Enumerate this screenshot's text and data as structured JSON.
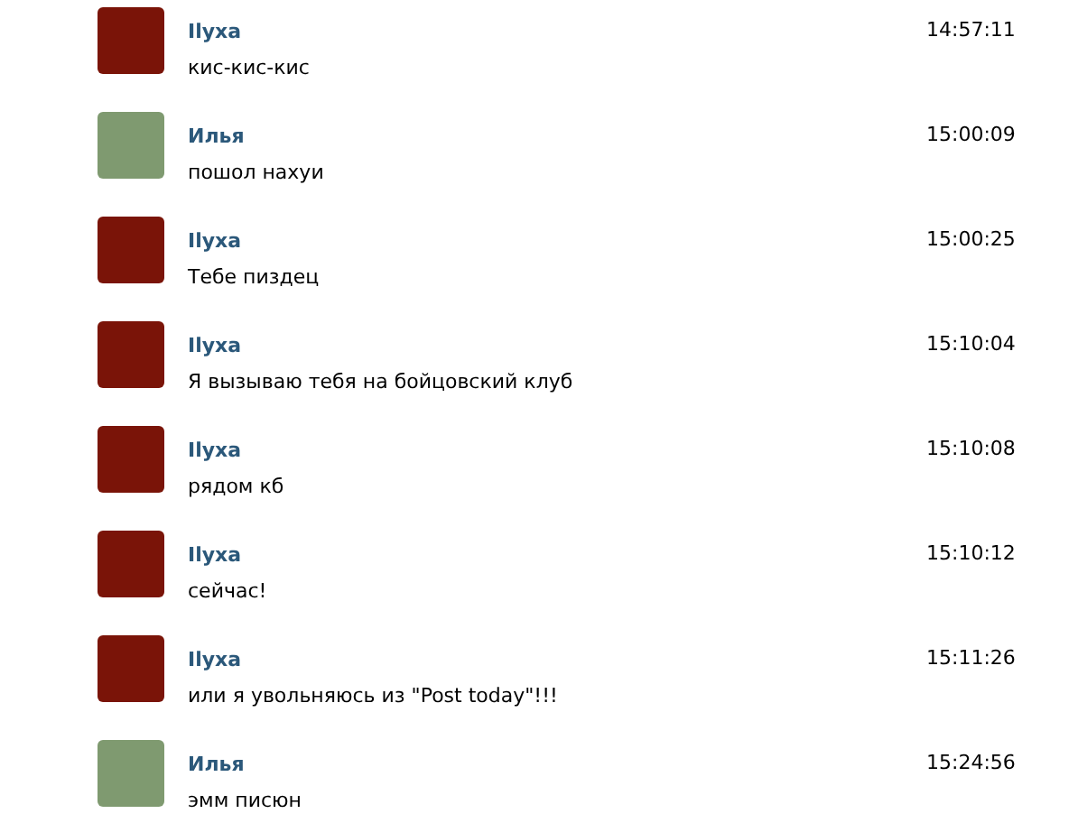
{
  "messages": [
    {
      "author": "Ilyxa",
      "text": "кис-кис-кис",
      "time": "14:57:11",
      "color": "#7a1408"
    },
    {
      "author": "Илья",
      "text": "пошол нахуи",
      "time": "15:00:09",
      "color": "#7f9a70"
    },
    {
      "author": "Ilyxa",
      "text": "Тебе пиздец",
      "time": "15:00:25",
      "color": "#7a1408"
    },
    {
      "author": "Ilyxa",
      "text": "Я вызываю тебя на бойцовский клуб",
      "time": "15:10:04",
      "color": "#7a1408"
    },
    {
      "author": "Ilyxa",
      "text": "рядом кб",
      "time": "15:10:08",
      "color": "#7a1408"
    },
    {
      "author": "Ilyxa",
      "text": "сейчас!",
      "time": "15:10:12",
      "color": "#7a1408"
    },
    {
      "author": "Ilyxa",
      "text": "или я увольняюсь из \"Post today\"!!!",
      "time": "15:11:26",
      "color": "#7a1408"
    },
    {
      "author": "Илья",
      "text": "эмм писюн",
      "time": "15:24:56",
      "color": "#7f9a70"
    }
  ]
}
